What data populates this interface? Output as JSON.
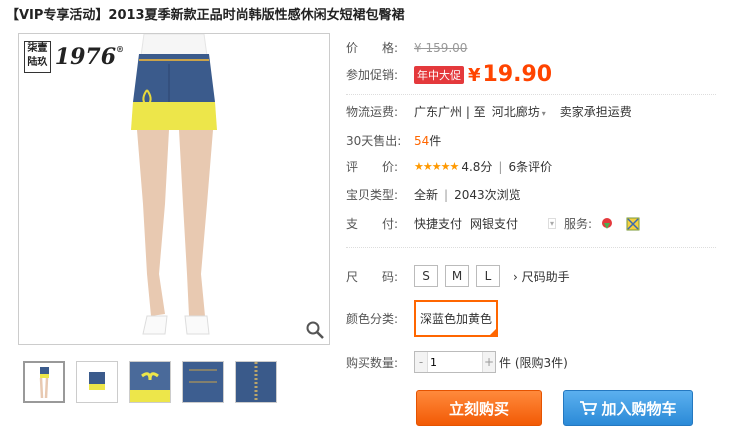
{
  "title": "【VIP专享活动】2013夏季新款正品时尚韩版性感休闲女短裙包臀裙",
  "logo": {
    "seal_text": "柒壹陆玖",
    "year": "1976",
    "reg": "®"
  },
  "price": {
    "label": "价　　格:",
    "original": "¥ 159.00"
  },
  "promo": {
    "label": "参加促销:",
    "badge": "年中大促",
    "currency": "¥",
    "value": "19.90"
  },
  "shipping": {
    "label": "物流运费:",
    "from": "广东广州 | 至",
    "to": "河北廊坊",
    "note": "卖家承担运费"
  },
  "sales": {
    "label": "30天售出:",
    "count": "54",
    "unit": "件"
  },
  "rating": {
    "label": "评　　价:",
    "stars": "★★★★★",
    "score": "4.8分",
    "sep": "|",
    "reviews": "6条评价"
  },
  "type": {
    "label": "宝贝类型:",
    "value": "全新",
    "sep": "|",
    "views": "2043次浏览"
  },
  "payment": {
    "label": "支　　付:",
    "method1": "快捷支付",
    "method2": "网银支付",
    "service_label": "服务:"
  },
  "size": {
    "label": "尺　　码:",
    "options": [
      "S",
      "M",
      "L"
    ],
    "helper": "尺码助手",
    "helper_arrow": "›"
  },
  "color": {
    "label": "颜色分类:",
    "selected": "深蓝色加黄色"
  },
  "quantity": {
    "label": "购买数量:",
    "minus": "-",
    "value": "1",
    "plus": "+",
    "unit": "件 (限购3件)"
  },
  "buttons": {
    "buy_now": "立刻购买",
    "add_cart": "加入购物车"
  },
  "colors": {
    "accent": "#f40",
    "buy": "#f25a05",
    "cart": "#2b8ad7",
    "promo_badge": "#e4393c"
  }
}
